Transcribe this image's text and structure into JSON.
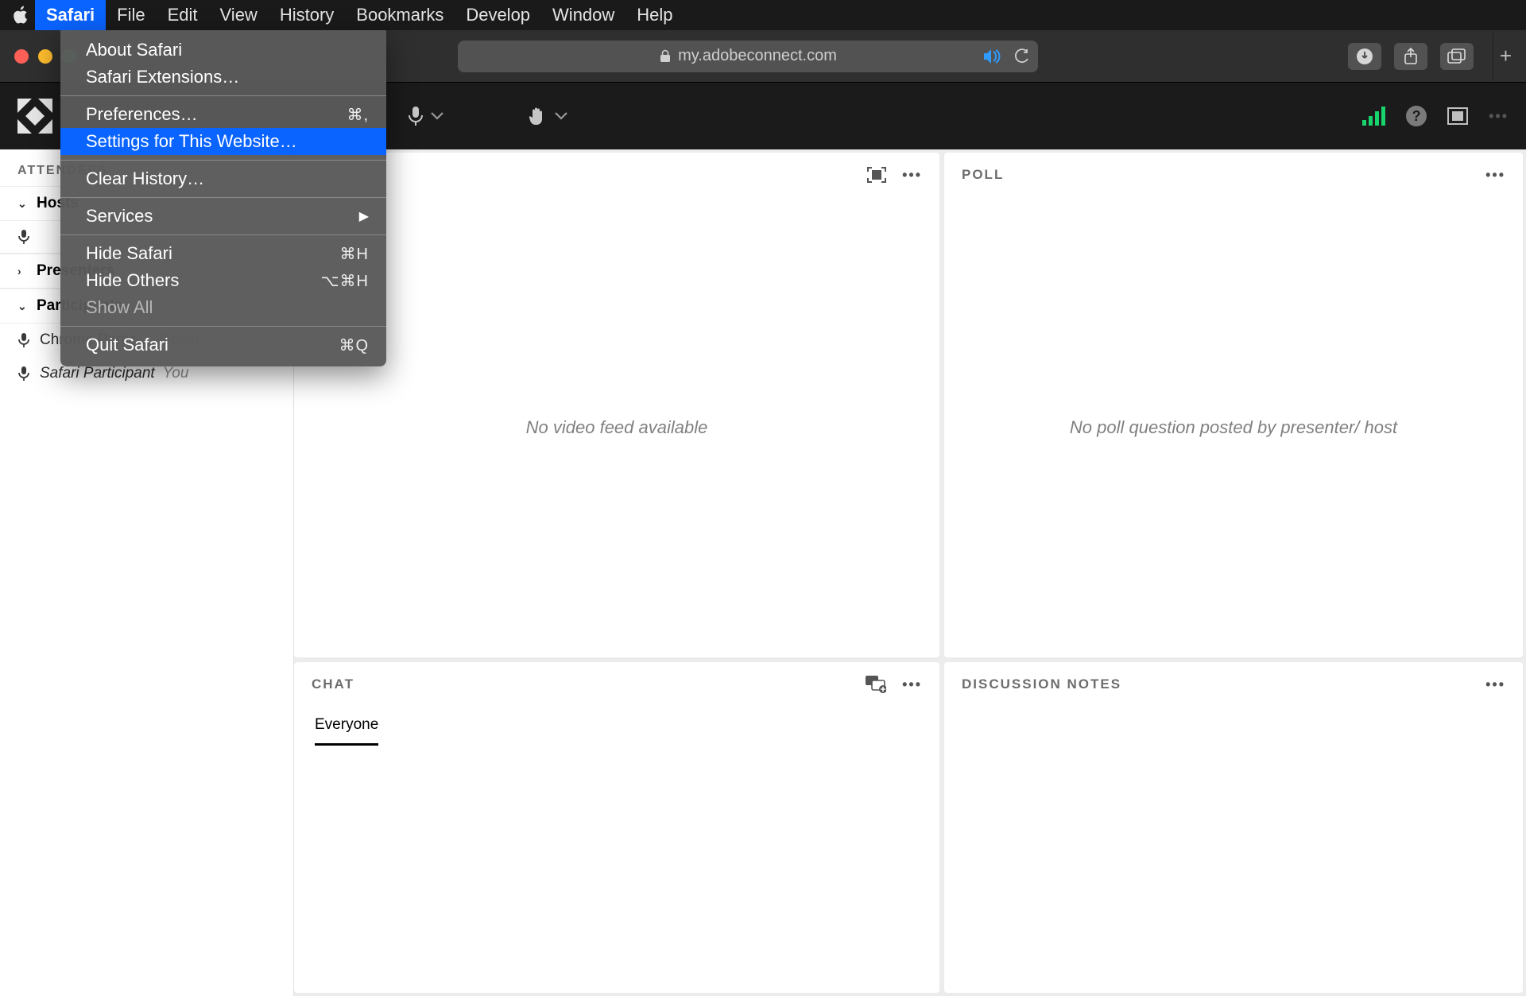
{
  "menubar": {
    "items": [
      "Safari",
      "File",
      "Edit",
      "View",
      "History",
      "Bookmarks",
      "Develop",
      "Window",
      "Help"
    ],
    "active_index": 0
  },
  "safari_menu": {
    "about": "About Safari",
    "extensions": "Safari Extensions…",
    "preferences": {
      "label": "Preferences…",
      "shortcut": "⌘,"
    },
    "settings_site": "Settings for This Website…",
    "clear_history": "Clear History…",
    "services": {
      "label": "Services",
      "arrow": "▶"
    },
    "hide_safari": {
      "label": "Hide Safari",
      "shortcut": "⌘H"
    },
    "hide_others": {
      "label": "Hide Others",
      "shortcut": "⌥⌘H"
    },
    "show_all": "Show All",
    "quit": {
      "label": "Quit Safari",
      "shortcut": "⌘Q"
    }
  },
  "browser": {
    "url": "my.adobeconnect.com"
  },
  "sidebar": {
    "title": "ATTENDEES",
    "groups": [
      {
        "label": "Hosts",
        "expanded": true
      },
      {
        "label": "Presenters",
        "expanded": false
      },
      {
        "label": "Participants",
        "expanded": true
      }
    ],
    "participants": [
      {
        "name": "Chrome Partic…",
        "tag": "Guest"
      },
      {
        "name": "Safari Participant",
        "tag": "You"
      }
    ]
  },
  "pods": {
    "video": {
      "placeholder": "No video feed available"
    },
    "poll": {
      "title": "POLL",
      "placeholder": "No poll question posted by presenter/ host"
    },
    "chat": {
      "title": "CHAT",
      "tab": "Everyone"
    },
    "notes": {
      "title": "DISCUSSION NOTES"
    }
  }
}
